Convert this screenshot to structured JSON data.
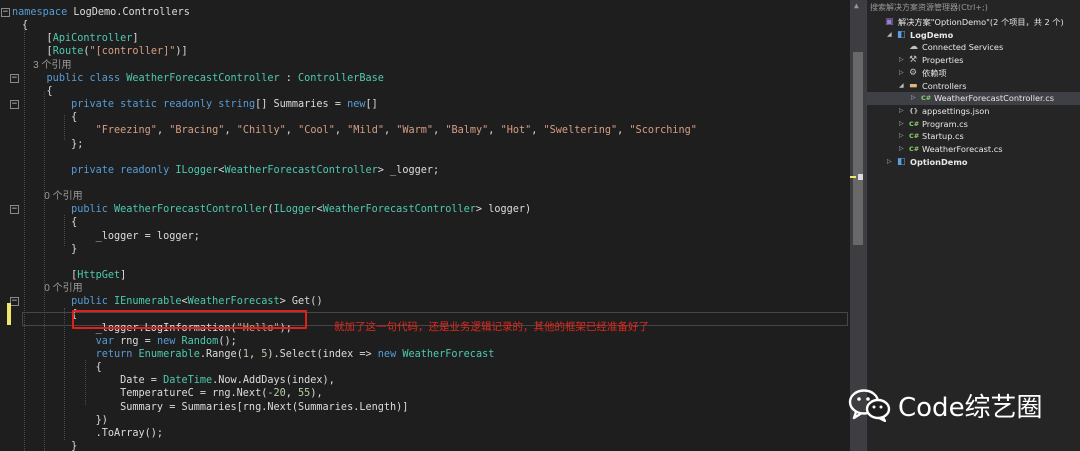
{
  "editor": {
    "lines": [
      {
        "parts": [
          [
            "kw",
            "namespace"
          ],
          [
            "ph",
            " LogDemo.Controllers"
          ]
        ]
      },
      {
        "parts": [
          [
            "ph",
            "{"
          ]
        ]
      },
      {
        "parts": [
          [
            "ph",
            "    "
          ],
          [
            "ph",
            "["
          ],
          [
            "attr",
            "ApiController"
          ],
          [
            "ph",
            "]"
          ]
        ]
      },
      {
        "parts": [
          [
            "ph",
            "    "
          ],
          [
            "ph",
            "["
          ],
          [
            "attr",
            "Route"
          ],
          [
            "ph",
            "("
          ],
          [
            "str",
            "\"[controller]\""
          ],
          [
            "ph",
            ")]"
          ]
        ]
      },
      {
        "ref": "    3 个引用"
      },
      {
        "parts": [
          [
            "ph",
            "    "
          ],
          [
            "kw",
            "public class "
          ],
          [
            "ty",
            "WeatherForecastController"
          ],
          [
            "ph",
            " : "
          ],
          [
            "ty",
            "ControllerBase"
          ]
        ]
      },
      {
        "parts": [
          [
            "ph",
            "    {"
          ]
        ]
      },
      {
        "parts": [
          [
            "ph",
            "        "
          ],
          [
            "kw",
            "private static readonly string"
          ],
          [
            "ph",
            "[] Summaries = "
          ],
          [
            "kw",
            "new"
          ],
          [
            "ph",
            "[]"
          ]
        ]
      },
      {
        "parts": [
          [
            "ph",
            "        {"
          ]
        ]
      },
      {
        "parts": [
          [
            "ph",
            "            "
          ],
          [
            "str",
            "\"Freezing\""
          ],
          [
            "ph",
            ", "
          ],
          [
            "str",
            "\"Bracing\""
          ],
          [
            "ph",
            ", "
          ],
          [
            "str",
            "\"Chilly\""
          ],
          [
            "ph",
            ", "
          ],
          [
            "str",
            "\"Cool\""
          ],
          [
            "ph",
            ", "
          ],
          [
            "str",
            "\"Mild\""
          ],
          [
            "ph",
            ", "
          ],
          [
            "str",
            "\"Warm\""
          ],
          [
            "ph",
            ", "
          ],
          [
            "str",
            "\"Balmy\""
          ],
          [
            "ph",
            ", "
          ],
          [
            "str",
            "\"Hot\""
          ],
          [
            "ph",
            ", "
          ],
          [
            "str",
            "\"Sweltering\""
          ],
          [
            "ph",
            ", "
          ],
          [
            "str",
            "\"Scorching\""
          ]
        ]
      },
      {
        "parts": [
          [
            "ph",
            "        };"
          ]
        ]
      },
      {
        "parts": [
          [
            "ph",
            ""
          ]
        ]
      },
      {
        "parts": [
          [
            "ph",
            "        "
          ],
          [
            "kw",
            "private readonly "
          ],
          [
            "ty",
            "ILogger"
          ],
          [
            "ph",
            "<"
          ],
          [
            "ty",
            "WeatherForecastController"
          ],
          [
            "ph",
            "> _logger;"
          ]
        ]
      },
      {
        "parts": [
          [
            "ph",
            ""
          ]
        ]
      },
      {
        "ref": "        0 个引用"
      },
      {
        "parts": [
          [
            "ph",
            "        "
          ],
          [
            "kw",
            "public "
          ],
          [
            "ty",
            "WeatherForecastController"
          ],
          [
            "ph",
            "("
          ],
          [
            "ty",
            "ILogger"
          ],
          [
            "ph",
            "<"
          ],
          [
            "ty",
            "WeatherForecastController"
          ],
          [
            "ph",
            "> logger)"
          ]
        ]
      },
      {
        "parts": [
          [
            "ph",
            "        {"
          ]
        ]
      },
      {
        "parts": [
          [
            "ph",
            "            _logger = logger;"
          ]
        ]
      },
      {
        "parts": [
          [
            "ph",
            "        }"
          ]
        ]
      },
      {
        "parts": [
          [
            "ph",
            ""
          ]
        ]
      },
      {
        "parts": [
          [
            "ph",
            "        ["
          ],
          [
            "attr",
            "HttpGet"
          ],
          [
            "ph",
            "]"
          ]
        ]
      },
      {
        "ref": "        0 个引用"
      },
      {
        "parts": [
          [
            "ph",
            "        "
          ],
          [
            "kw",
            "public "
          ],
          [
            "ty",
            "IEnumerable"
          ],
          [
            "ph",
            "<"
          ],
          [
            "ty",
            "WeatherForecast"
          ],
          [
            "ph",
            "> Get()"
          ]
        ]
      },
      {
        "parts": [
          [
            "ph",
            "        {"
          ]
        ]
      },
      {
        "parts": [
          [
            "ph",
            "            _logger.LogInformation("
          ],
          [
            "str",
            "\"Hello\""
          ],
          [
            "ph",
            ");"
          ]
        ]
      },
      {
        "parts": [
          [
            "ph",
            "            "
          ],
          [
            "kw",
            "var"
          ],
          [
            "ph",
            " rng = "
          ],
          [
            "kw",
            "new "
          ],
          [
            "ty",
            "Random"
          ],
          [
            "ph",
            "();"
          ]
        ]
      },
      {
        "parts": [
          [
            "ph",
            "            "
          ],
          [
            "kw",
            "return "
          ],
          [
            "ty",
            "Enumerable"
          ],
          [
            "ph",
            ".Range("
          ],
          [
            "num",
            "1"
          ],
          [
            "ph",
            ", "
          ],
          [
            "num",
            "5"
          ],
          [
            "ph",
            ").Select(index => "
          ],
          [
            "kw",
            "new "
          ],
          [
            "ty",
            "WeatherForecast"
          ]
        ]
      },
      {
        "parts": [
          [
            "ph",
            "            {"
          ]
        ]
      },
      {
        "parts": [
          [
            "ph",
            "                Date = "
          ],
          [
            "ty",
            "DateTime"
          ],
          [
            "ph",
            ".Now.AddDays(index),"
          ]
        ]
      },
      {
        "parts": [
          [
            "ph",
            "                TemperatureC = rng.Next("
          ],
          [
            "num",
            "-20"
          ],
          [
            "ph",
            ", "
          ],
          [
            "num",
            "55"
          ],
          [
            "ph",
            "),"
          ]
        ]
      },
      {
        "parts": [
          [
            "ph",
            "                Summary = Summaries[rng.Next(Summaries.Length)]"
          ]
        ]
      },
      {
        "parts": [
          [
            "ph",
            "            })"
          ]
        ]
      },
      {
        "parts": [
          [
            "ph",
            "            .ToArray();"
          ]
        ]
      },
      {
        "parts": [
          [
            "ph",
            "        }"
          ]
        ]
      },
      {
        "parts": [
          [
            "ph",
            "    }"
          ]
        ]
      }
    ],
    "annotation": "就加了这一句代码，还是业务逻辑记录的，其他的框架已经准备好了",
    "colors": {
      "highlight_box": "#e0201a",
      "annotation": "#e02a1f"
    }
  },
  "solution_explorer": {
    "search_placeholder": "搜索解决方案资源管理器(Ctrl+;)",
    "items": [
      {
        "label": "解决方案\"OptionDemo\"(2 个项目，共 2 个)",
        "icon": "solution-icon",
        "tri": "",
        "selected": false,
        "bold": false
      },
      {
        "label": "LogDemo",
        "icon": "project-icon",
        "tri": "◢",
        "selected": false,
        "bold": true
      },
      {
        "label": "Connected Services",
        "icon": "connected-services-icon",
        "tri": "",
        "selected": false,
        "bold": false
      },
      {
        "label": "Properties",
        "icon": "wrench-icon",
        "tri": "▷",
        "selected": false,
        "bold": false
      },
      {
        "label": "依赖项",
        "icon": "dependencies-icon",
        "tri": "▷",
        "selected": false,
        "bold": false
      },
      {
        "label": "Controllers",
        "icon": "folder-icon",
        "tri": "◢",
        "selected": false,
        "bold": false
      },
      {
        "label": "WeatherForecastController.cs",
        "icon": "csharp-file-icon",
        "tri": "▷",
        "selected": true,
        "bold": false
      },
      {
        "label": "appsettings.json",
        "icon": "json-file-icon",
        "tri": "▷",
        "selected": false,
        "bold": false
      },
      {
        "label": "Program.cs",
        "icon": "csharp-file-icon",
        "tri": "▷",
        "selected": false,
        "bold": false
      },
      {
        "label": "Startup.cs",
        "icon": "csharp-file-icon",
        "tri": "▷",
        "selected": false,
        "bold": false
      },
      {
        "label": "WeatherForecast.cs",
        "icon": "csharp-file-icon",
        "tri": "▷",
        "selected": false,
        "bold": false
      },
      {
        "label": "OptionDemo",
        "icon": "project-icon",
        "tri": "▷",
        "selected": false,
        "bold": true
      }
    ]
  },
  "watermark": {
    "text": "Code综艺圈",
    "icon": "wechat-icon"
  }
}
